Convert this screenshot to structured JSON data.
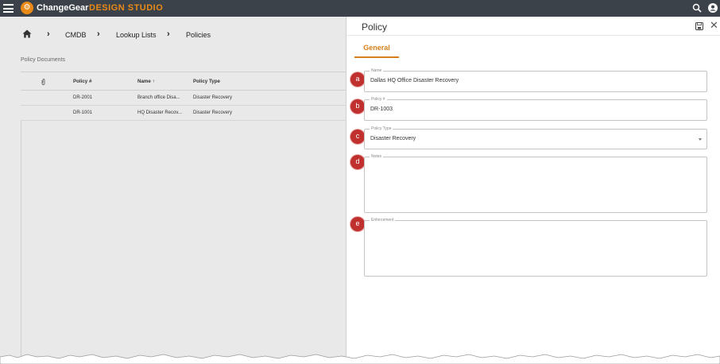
{
  "app": {
    "brand": "ChangeGear",
    "subtitle": "DESIGN STUDIO"
  },
  "breadcrumb": {
    "items": [
      "CMDB",
      "Lookup Lists",
      "Policies"
    ]
  },
  "list": {
    "title": "Policy Documents",
    "columns": [
      "Policy #",
      "Name ↑",
      "Policy Type"
    ],
    "rows": [
      {
        "number": "DR-2001",
        "name": "Branch office Disa...",
        "type": "Disaster Recovery"
      },
      {
        "number": "DR-1001",
        "name": "HQ Disaster Recov...",
        "type": "Disaster Recovery"
      }
    ]
  },
  "panel": {
    "title": "Policy",
    "tab": "General",
    "fields": {
      "name": {
        "label": "Name",
        "value": "Dallas HQ Office Disaster Recovery",
        "badge": "a"
      },
      "policy_number": {
        "label": "Policy #",
        "value": "DR-1003",
        "badge": "b"
      },
      "policy_type": {
        "label": "Policy Type",
        "value": "Disaster Recovery",
        "badge": "c"
      },
      "notes": {
        "label": "Notes",
        "value": "",
        "badge": "d"
      },
      "enforcement": {
        "label": "Enforcement",
        "value": "",
        "badge": "e"
      }
    }
  },
  "colors": {
    "topbar": "#3b4249",
    "accent": "#e98a17",
    "tab_accent": "#d4801a",
    "badge": "#c0302e",
    "overlay_bg": "#e9e9e9"
  }
}
